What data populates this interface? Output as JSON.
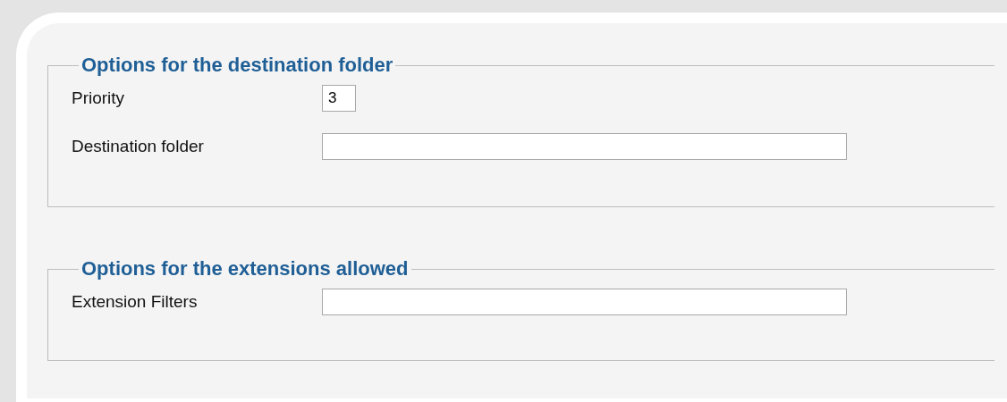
{
  "sections": [
    {
      "legend": "Options for the destination folder",
      "fields": [
        {
          "label": "Priority",
          "value": "3",
          "kind": "short"
        },
        {
          "label": "Destination folder",
          "kind": "wide"
        }
      ]
    },
    {
      "legend": "Options for the extensions allowed",
      "fields": [
        {
          "label": "Extension Filters",
          "kind": "wide"
        }
      ]
    }
  ]
}
